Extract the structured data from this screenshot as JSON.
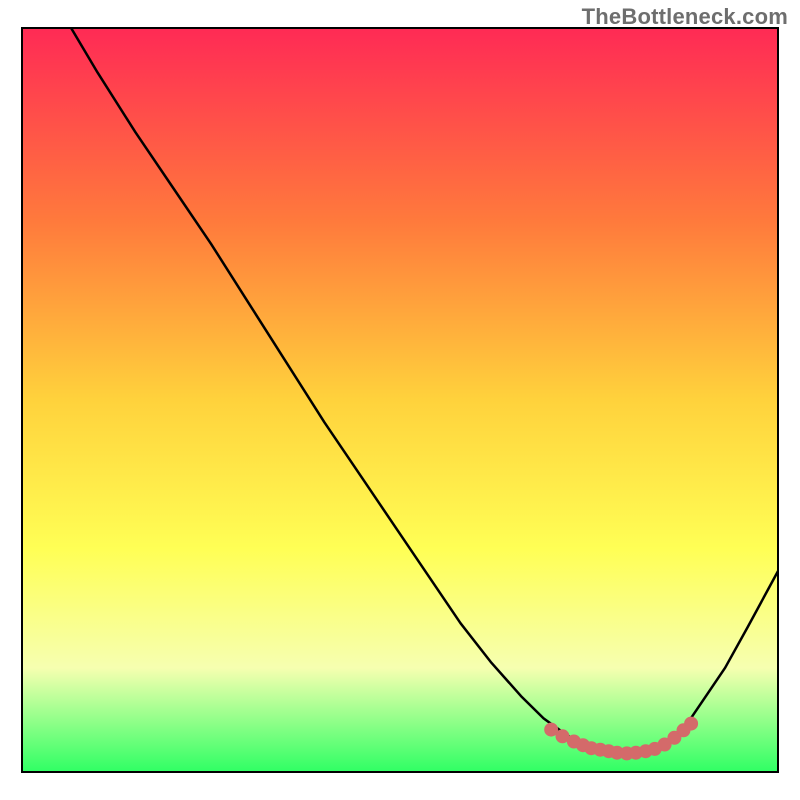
{
  "watermark": "TheBottleneck.com",
  "colors": {
    "gradient_top": "#ff2a55",
    "gradient_mid1": "#ff7a3c",
    "gradient_mid2": "#ffd23c",
    "gradient_mid3": "#ffff55",
    "gradient_mid4": "#f6ffb0",
    "gradient_bottom": "#2fff64",
    "border": "#000000",
    "curve": "#000000",
    "marker_fill": "#d46a6a",
    "marker_stroke": "#d46a6a"
  },
  "chart_data": {
    "type": "line",
    "title": "",
    "xlabel": "",
    "ylabel": "",
    "xlim": [
      0,
      100
    ],
    "ylim": [
      0,
      100
    ],
    "note": "Axes unlabeled; values are fractional positions read from pixel coordinates (0-100 scale). Curve depicts bottleneck % (y) vs some x. Lower band (~y<8) is optimal (green).",
    "series": [
      {
        "name": "bottleneck-curve",
        "x": [
          6.5,
          10,
          15,
          20,
          25,
          30,
          35,
          40,
          45,
          50,
          55,
          58,
          62,
          66,
          69,
          72,
          74,
          76,
          78,
          80,
          82,
          84,
          86,
          88,
          90,
          93,
          96,
          100
        ],
        "y": [
          100,
          94,
          86,
          78.5,
          71,
          63,
          55,
          47,
          39.5,
          32,
          24.5,
          20,
          14.8,
          10.2,
          7.2,
          5.0,
          3.8,
          3.0,
          2.6,
          2.5,
          2.6,
          3.2,
          4.4,
          6.5,
          9.5,
          14,
          19.5,
          27
        ]
      }
    ],
    "highlight_points": {
      "name": "optimal-range-markers",
      "x": [
        70,
        71.5,
        73,
        74.2,
        75.3,
        76.5,
        77.6,
        78.7,
        80,
        81.2,
        82.5,
        83.7,
        85,
        86.3,
        87.5,
        88.5
      ],
      "y": [
        5.7,
        4.8,
        4.1,
        3.6,
        3.2,
        3.0,
        2.8,
        2.6,
        2.5,
        2.6,
        2.8,
        3.1,
        3.7,
        4.6,
        5.6,
        6.5
      ]
    }
  }
}
